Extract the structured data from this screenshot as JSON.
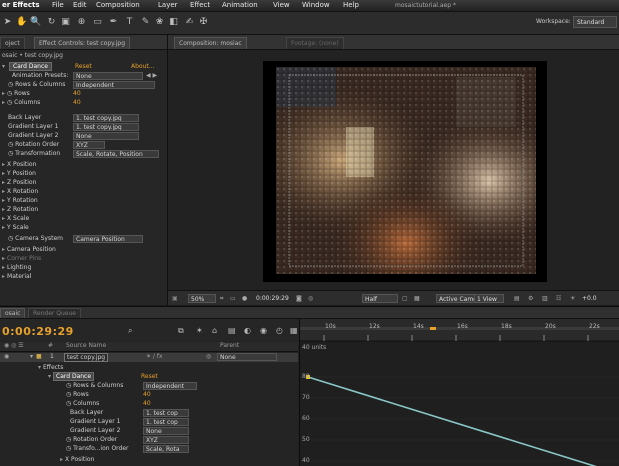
{
  "menu": {
    "app": "er Effects",
    "items": [
      "File",
      "Edit",
      "Composition",
      "Layer",
      "Effect",
      "Animation",
      "View",
      "Window",
      "Help"
    ],
    "doc_title": "mosaictutorial.aep *"
  },
  "toolbar": {
    "workspace_label": "Workspace:",
    "workspace_value": "Standard"
  },
  "left_panel": {
    "tab_project": "oject",
    "tab_effect_controls": "Effect Controls: test copy.jpg",
    "breadcrumb": "osaic • test copy.jpg",
    "effect_name": "Card Dance",
    "reset_label": "Reset",
    "about_label": "About...",
    "properties": [
      {
        "label": "Animation Presets:",
        "value": "None",
        "nav": "◀ ▶"
      },
      {
        "label": "Rows & Columns",
        "value": "Independent"
      },
      {
        "label": "Rows",
        "value": "40"
      },
      {
        "label": "Columns",
        "value": "40"
      },
      {
        "label": "Back Layer",
        "value": "1. test copy.jpg"
      },
      {
        "label": "Gradient Layer 1",
        "value": "1. test copy.jpg"
      },
      {
        "label": "Gradient Layer 2",
        "value": "None"
      },
      {
        "label": "Rotation Order",
        "value": "XYZ"
      },
      {
        "label": "Transformation",
        "value": "Scale, Rotate, Position"
      }
    ],
    "groups": [
      "X Position",
      "Y Position",
      "Z Position",
      "X Rotation",
      "Y Rotation",
      "Z Rotation",
      "X Scale",
      "Y Scale"
    ],
    "camera_system_label": "Camera System",
    "camera_system_value": "Camera Position",
    "trailing_groups": [
      "Camera Position",
      "Corner Pins",
      "Lighting",
      "Material"
    ]
  },
  "comp_panel": {
    "tab_comp": "Composition: mosiac",
    "tab_footage": "Footage: (none)",
    "zoom": "50%",
    "timecode": "0:00:29:29",
    "resolution": "Half",
    "camera": "Active Camera",
    "views": "1 View",
    "exposure": "+0.0"
  },
  "timeline": {
    "tab_mosaic": "osaic",
    "tab_render": "Render Queue",
    "timecode": "0:00:29:29",
    "ruler": [
      "10s",
      "12s",
      "14s",
      "16s",
      "18s",
      "20s",
      "22s"
    ],
    "col_source": "Source Name",
    "col_parent": "Parent",
    "layer_num": "1",
    "layer_name": "test copy.jpg",
    "parent_value": "None",
    "effects_label": "Effects",
    "effect_name": "Card Dance",
    "reset_label": "Reset",
    "rows": [
      {
        "label": "Rows & Columns",
        "value": "Independent"
      },
      {
        "label": "Rows",
        "value": "40"
      },
      {
        "label": "Columns",
        "value": "40"
      },
      {
        "label": "Back Layer",
        "value": "1. test cop"
      },
      {
        "label": "Gradient Layer 1",
        "value": "1. test cop"
      },
      {
        "label": "Gradient Layer 2",
        "value": "None"
      },
      {
        "label": "Rotation Order",
        "value": "XYZ"
      },
      {
        "label": "Transfo...ion Order",
        "value": "Scale, Rota"
      }
    ],
    "last_group": "X Position",
    "graph_header": "40 units",
    "graph_ticks": [
      "80",
      "70",
      "60",
      "50",
      "40",
      "30",
      "20"
    ]
  }
}
